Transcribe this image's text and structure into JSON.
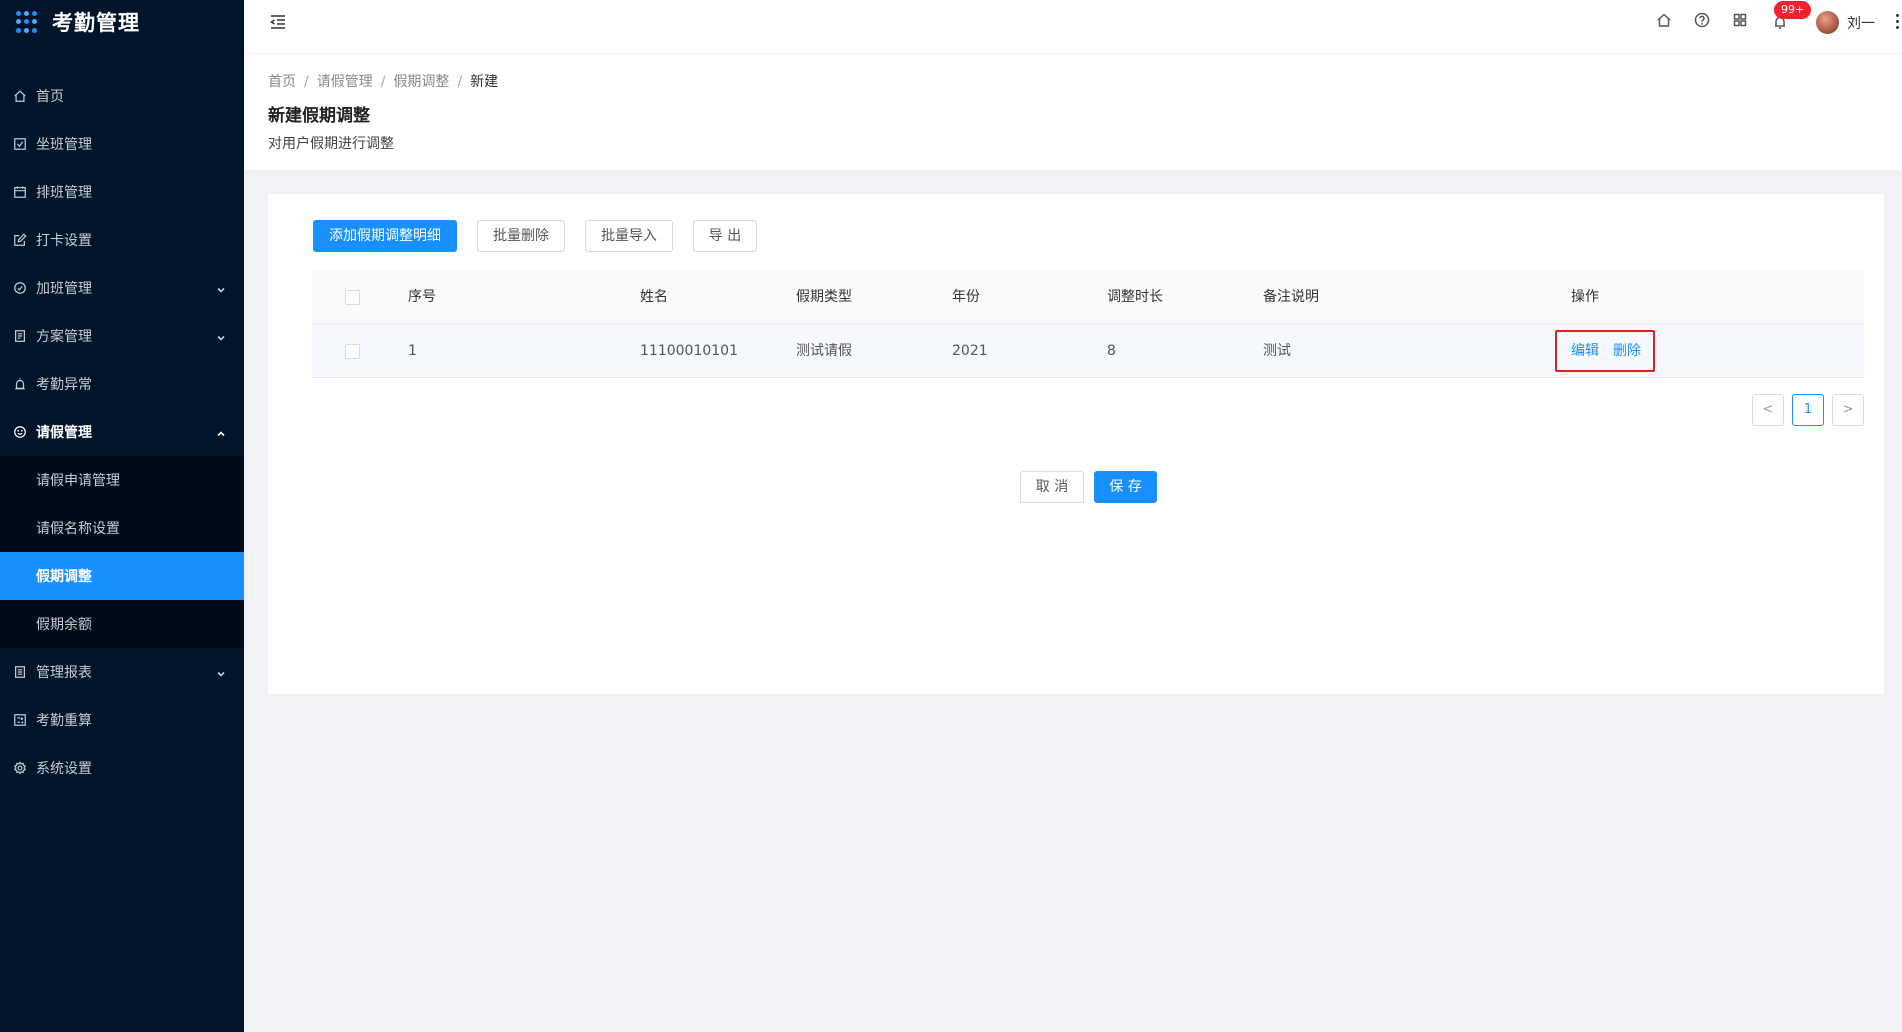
{
  "app": {
    "title": "考勤管理"
  },
  "sidebar": {
    "items": [
      {
        "label": "首页",
        "icon": "home-icon"
      },
      {
        "label": "坐班管理",
        "icon": "check-square-icon"
      },
      {
        "label": "排班管理",
        "icon": "calendar-icon"
      },
      {
        "label": "打卡设置",
        "icon": "edit-icon"
      },
      {
        "label": "加班管理",
        "icon": "clock-icon"
      },
      {
        "label": "方案管理",
        "icon": "document-icon"
      },
      {
        "label": "考勤异常",
        "icon": "alarm-icon"
      },
      {
        "label": "请假管理",
        "icon": "smile-icon"
      },
      {
        "label": "管理报表",
        "icon": "report-icon"
      },
      {
        "label": "考勤重算",
        "icon": "calculator-icon"
      },
      {
        "label": "系统设置",
        "icon": "settings-icon"
      }
    ],
    "sub_items": [
      {
        "label": "请假申请管理"
      },
      {
        "label": "请假名称设置"
      },
      {
        "label": "假期调整"
      },
      {
        "label": "假期余额"
      }
    ]
  },
  "header": {
    "notification_badge": "99+",
    "username": "刘一"
  },
  "breadcrumb": [
    "首页",
    "请假管理",
    "假期调整",
    "新建"
  ],
  "page": {
    "title": "新建假期调整",
    "description": "对用户假期进行调整"
  },
  "toolbar": {
    "add_label": "添加假期调整明细",
    "batch_delete_label": "批量删除",
    "batch_import_label": "批量导入",
    "export_label": "导 出"
  },
  "table": {
    "columns": [
      "序号",
      "姓名",
      "假期类型",
      "年份",
      "调整时长",
      "备注说明",
      "操作"
    ],
    "rows": [
      {
        "index": "1",
        "name": "11100010101",
        "type": "测试请假",
        "year": "2021",
        "duration": "8",
        "note": "测试",
        "edit": "编辑",
        "delete": "删除"
      }
    ]
  },
  "pagination": {
    "current": "1",
    "prev": "<",
    "next": ">"
  },
  "footer": {
    "cancel_label": "取 消",
    "save_label": "保 存"
  },
  "colors": {
    "primary": "#1890ff",
    "sidebar_bg": "#001529",
    "highlight": "#e02020"
  }
}
